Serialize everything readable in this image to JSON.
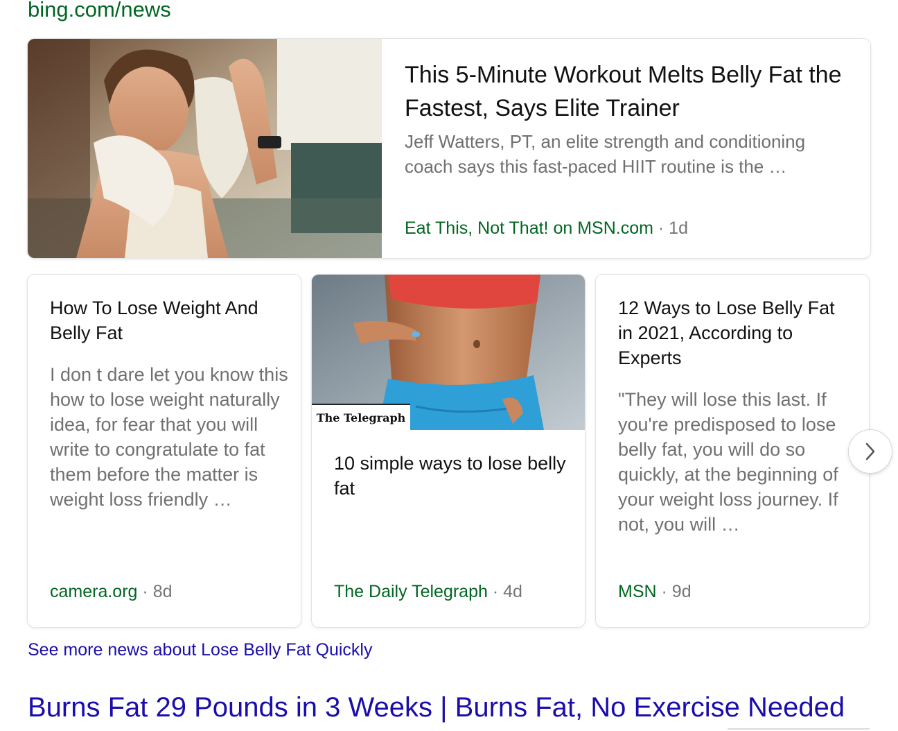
{
  "source_url": "bing.com/news",
  "top_story": {
    "title": "This 5-Minute Workout Melts Belly Fat the Fastest, Says Elite Trainer",
    "snippet": "Jeff Watters, PT, an elite strength and conditioning coach says this fast-paced HIIT routine is the …",
    "source": "Eat This, Not That! on MSN.com",
    "separator": "·",
    "age": "1d"
  },
  "cards": [
    {
      "title": "How To Lose Weight And Belly Fat",
      "snippet": "I don t dare let you know this how to lose weight naturally idea, for fear that you will write to congratulate to fat them before the matter is weight loss friendly …",
      "source": "camera.org",
      "separator": "·",
      "age": "8d"
    },
    {
      "title": "10 simple ways to lose belly fat",
      "image_badge": "The Telegraph",
      "source": "The Daily Telegraph",
      "separator": "·",
      "age": "4d"
    },
    {
      "title": "12 Ways to Lose Belly Fat in 2021, According to Experts",
      "snippet": "\"They will lose this last. If you're predisposed to lose belly fat, you will do so quickly, at the beginning of your weight loss journey. If not, you will …",
      "source": "MSN",
      "separator": "·",
      "age": "9d"
    }
  ],
  "see_more_link": "See more news about Lose Belly Fat Quickly",
  "next_result_title": "Burns Fat 29 Pounds in 3 Weeks | Burns Fat, No Exercise Needed",
  "icons": {
    "next": "chevron-right-icon"
  },
  "colors": {
    "source_green": "#006621",
    "link_blue": "#1a0dab",
    "snippet_gray": "#707070"
  }
}
